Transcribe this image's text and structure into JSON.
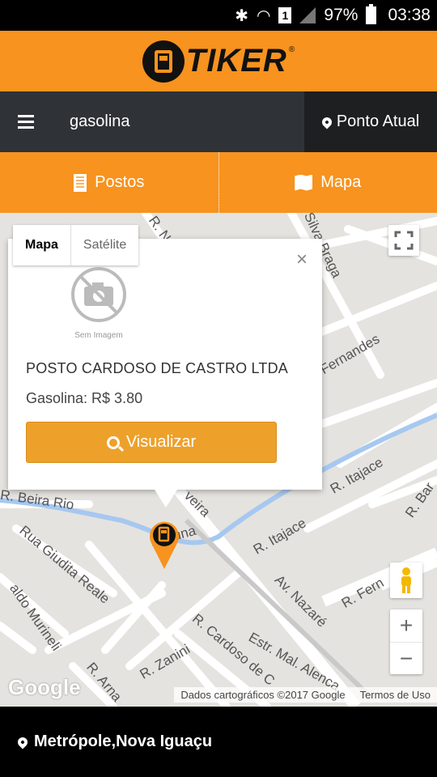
{
  "status_bar": {
    "battery": "97%",
    "time": "03:38",
    "sim_label": "1"
  },
  "header": {
    "brand": "TIKER",
    "brand_mark": "®"
  },
  "search": {
    "query": "gasolina",
    "location_button": "Ponto Atual"
  },
  "tabs": [
    {
      "label": "Postos",
      "icon": "building-icon"
    },
    {
      "label": "Mapa",
      "icon": "map-icon"
    }
  ],
  "map": {
    "map_type": {
      "options": [
        "Mapa",
        "Satélite"
      ],
      "selected": "Mapa"
    },
    "roads": [
      "R. N",
      "Silva Braga",
      "Fernandes",
      "R. Beira Rio",
      "R. Itajace",
      "R. Itajace",
      "R. Bar",
      "Rua Giudita Reale",
      "aldo Murineli",
      "Pavuna",
      "veira",
      "Av. Nazaré",
      "R. Fern",
      "R. Cardoso de C",
      "R. Zanini",
      "Estr. Mal. Alenca",
      "R. Arna"
    ],
    "google_logo": "Google",
    "attribution": "Dados cartográficos ©2017 Google",
    "terms": "Termos de Uso",
    "zoom_in": "+",
    "zoom_out": "−"
  },
  "info_window": {
    "no_image_label": "Sem Imagem",
    "station_name": "POSTO CARDOSO DE CASTRO LTDA",
    "price": "Gasolina: R$ 3.80",
    "button": "Visualizar",
    "close": "×"
  },
  "footer": {
    "location": "Metrópole,Nova Iguaçu"
  },
  "colors": {
    "accent": "#f7931e",
    "button": "#eda12b",
    "dark": "#2f3236"
  }
}
